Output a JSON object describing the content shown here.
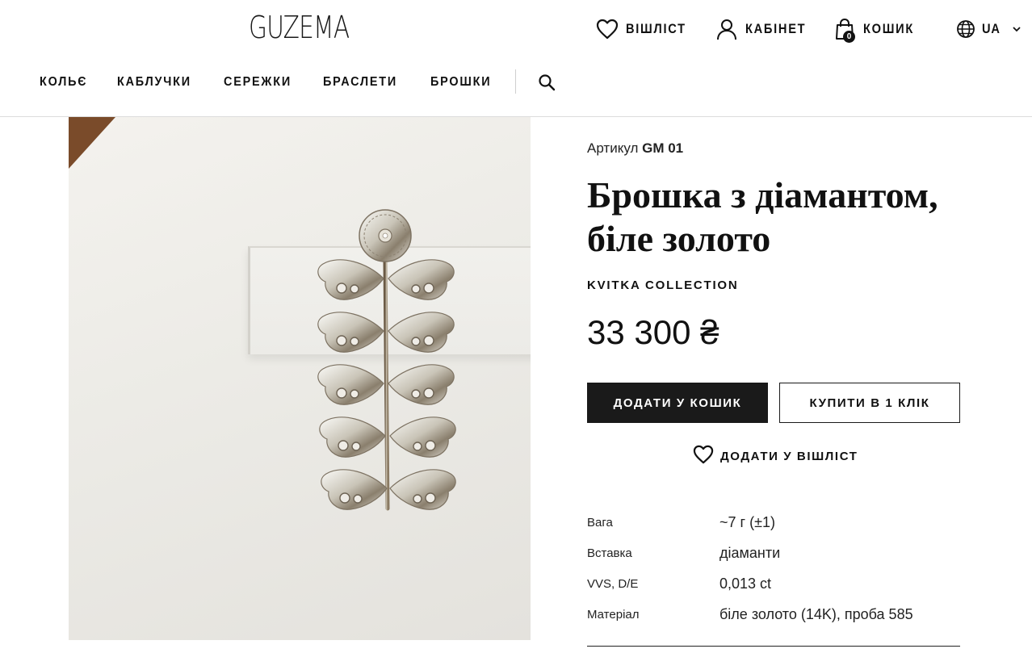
{
  "header": {
    "logo": "GUZEMA",
    "wishlist_label": "ВІШЛІСТ",
    "account_label": "КАБІНЕТ",
    "cart_label": "КОШИК",
    "cart_count": "0",
    "language": "UA",
    "icons": [
      "heart-icon",
      "user-icon",
      "bag-icon",
      "globe-icon",
      "chevron-down-icon",
      "search-icon"
    ]
  },
  "nav": {
    "items": [
      "КОЛЬЄ",
      "КАБЛУЧКИ",
      "СЕРЕЖКИ",
      "БРАСЛЕТИ",
      "БРОШКИ"
    ]
  },
  "product": {
    "sku_label": "Артикул",
    "sku_value": "GM 01",
    "title": "Брошка з діамантом, біле золото",
    "collection": "KVITKA COLLECTION",
    "price": "33 300 ₴",
    "add_to_cart": "ДОДАТИ У КОШИК",
    "buy_one_click": "КУПИТИ В 1 КЛІК",
    "add_to_wishlist": "ДОДАТИ У ВІШЛІСТ",
    "specs": [
      {
        "key": "Вага",
        "value": "~7 г (±1)"
      },
      {
        "key": "Вставка",
        "value": "діаманти"
      },
      {
        "key": "VVS, D/E",
        "value": "0,013 ct"
      },
      {
        "key": "Матеріал",
        "value": "біле золото (14K), проба 585"
      }
    ]
  },
  "colors": {
    "primary_button": "#1a1a1a",
    "text": "#111111",
    "border": "#dcdcdc"
  }
}
